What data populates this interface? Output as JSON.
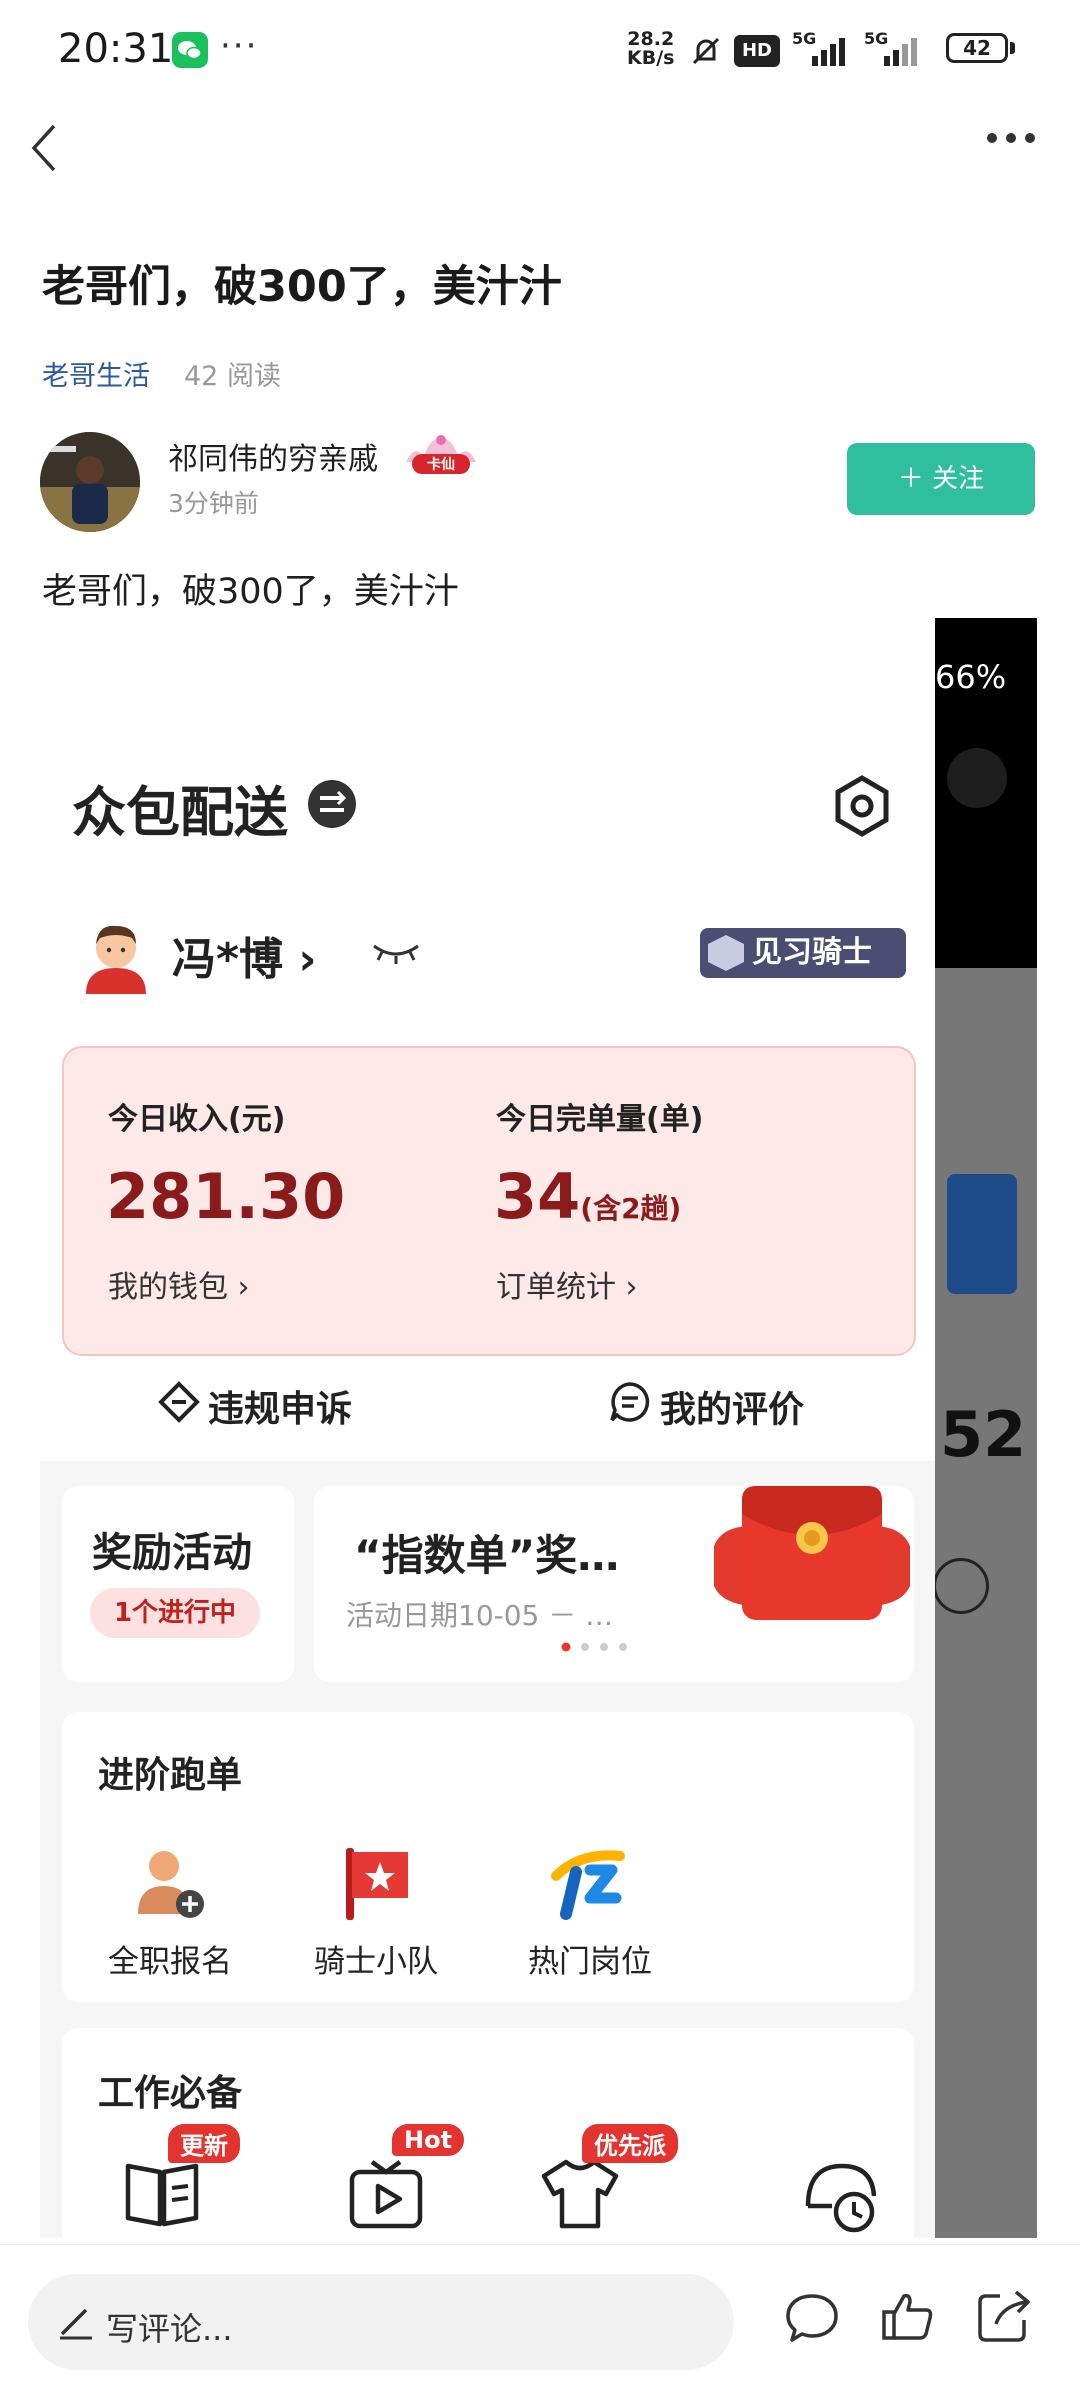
{
  "status_bar": {
    "time": "20:31",
    "more": "···",
    "net_speed_value": "28.2",
    "net_speed_unit": "KB/s",
    "hd": "HD",
    "signal_1": "5G",
    "signal_2": "5G",
    "battery": "42"
  },
  "post": {
    "title": "老哥们，破300了，美汁汁",
    "category": "老哥生活",
    "read_count": "42 阅读",
    "author": "祁同伟的穷亲戚",
    "badge": "卡仙",
    "time": "3分钟前",
    "follow_label": "＋ 关注",
    "body": "老哥们，破300了，美汁汁"
  },
  "app": {
    "title": "众包配送",
    "rider_name": "冯*博",
    "rider_chevron": "›",
    "level": "见习骑士",
    "earnings": {
      "income_label": "今日收入(元)",
      "income_value": "281.30",
      "wallet_link": "我的钱包 ›",
      "orders_label": "今日完单量(单)",
      "orders_value": "34",
      "orders_note": "(含2趟)",
      "orders_link": "订单统计 ›"
    },
    "quick_actions": {
      "appeal": "违规申诉",
      "reviews": "我的评价"
    },
    "reward": {
      "title": "奖励活动",
      "running": "1个进行中"
    },
    "promo": {
      "title": "“指数单”奖…",
      "date": "活动日期10-05 － …"
    },
    "advanced": {
      "title": "进阶跑单",
      "items": [
        "全职报名",
        "骑士小队",
        "热门岗位"
      ]
    },
    "essentials": {
      "title": "工作必备",
      "tags": [
        "更新",
        "Hot",
        "优先派"
      ]
    },
    "right_peek": {
      "percent": "66%",
      "number": "52"
    }
  },
  "bottom_bar": {
    "comment_placeholder": "写评论..."
  }
}
